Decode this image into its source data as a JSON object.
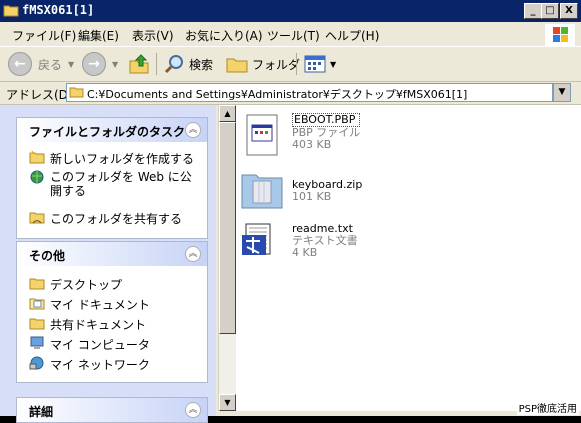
{
  "window": {
    "title": "fMSX061[1]",
    "controls": [
      "_",
      "□",
      "X"
    ]
  },
  "menu": {
    "items": [
      "ファイル(F)",
      "編集(E)",
      "表示(V)",
      "お気に入り(A)",
      "ツール(T)",
      "ヘルプ(H)"
    ]
  },
  "toolbar": {
    "back_label": "戻る",
    "search_label": "検索",
    "folder_label": "フォルダ"
  },
  "address": {
    "label": "アドレス(D)",
    "value": "C:¥Documents and Settings¥Administrator¥デスクトップ¥fMSX061[1]"
  },
  "tasks_panel": {
    "title": "ファイルとフォルダのタスク",
    "items": [
      {
        "label": "新しいフォルダを作成する",
        "icon": "new-folder-icon"
      },
      {
        "label": "このフォルダを Web に公開する",
        "icon": "web-publish-icon"
      },
      {
        "label": "このフォルダを共有する",
        "icon": "share-folder-icon"
      }
    ]
  },
  "other_panel": {
    "title": "その他",
    "items": [
      {
        "label": "デスクトップ",
        "icon": "desktop-folder-icon"
      },
      {
        "label": "マイ ドキュメント",
        "icon": "my-documents-icon"
      },
      {
        "label": "共有ドキュメント",
        "icon": "shared-documents-icon"
      },
      {
        "label": "マイ コンピュータ",
        "icon": "my-computer-icon"
      },
      {
        "label": "マイ ネットワーク",
        "icon": "my-network-icon"
      }
    ]
  },
  "details_panel": {
    "title": "詳細"
  },
  "files": [
    {
      "name": "EBOOT.PBP",
      "type": "PBP ファイル",
      "size": "403 KB",
      "icon": "pbp-file-icon"
    },
    {
      "name": "keyboard.zip",
      "type": "",
      "size": "101 KB",
      "icon": "zip-folder-icon"
    },
    {
      "name": "readme.txt",
      "type": "テキスト文書",
      "size": "4 KB",
      "icon": "text-document-icon"
    }
  ],
  "watermark": "PSP徹底活用",
  "colors": {
    "titlebar": "#0a246a",
    "window_face": "#ece9d8",
    "task_pane": "#d6dff7"
  }
}
